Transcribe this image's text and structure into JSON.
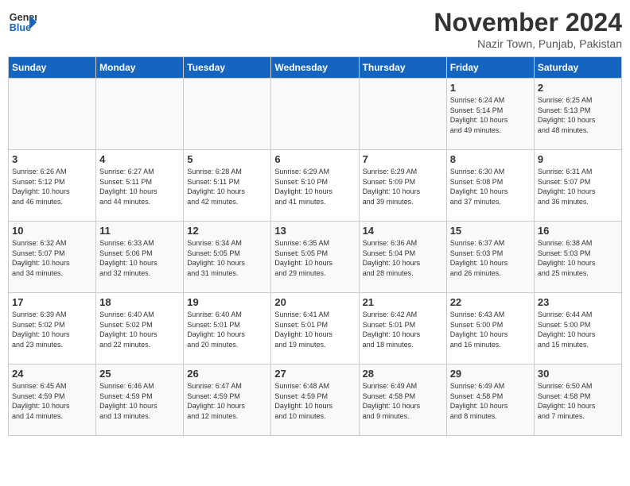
{
  "logo": {
    "line1": "General",
    "line2": "Blue"
  },
  "title": "November 2024",
  "location": "Nazir Town, Punjab, Pakistan",
  "days_header": [
    "Sunday",
    "Monday",
    "Tuesday",
    "Wednesday",
    "Thursday",
    "Friday",
    "Saturday"
  ],
  "weeks": [
    [
      {
        "day": "",
        "info": ""
      },
      {
        "day": "",
        "info": ""
      },
      {
        "day": "",
        "info": ""
      },
      {
        "day": "",
        "info": ""
      },
      {
        "day": "",
        "info": ""
      },
      {
        "day": "1",
        "info": "Sunrise: 6:24 AM\nSunset: 5:14 PM\nDaylight: 10 hours\nand 49 minutes."
      },
      {
        "day": "2",
        "info": "Sunrise: 6:25 AM\nSunset: 5:13 PM\nDaylight: 10 hours\nand 48 minutes."
      }
    ],
    [
      {
        "day": "3",
        "info": "Sunrise: 6:26 AM\nSunset: 5:12 PM\nDaylight: 10 hours\nand 46 minutes."
      },
      {
        "day": "4",
        "info": "Sunrise: 6:27 AM\nSunset: 5:11 PM\nDaylight: 10 hours\nand 44 minutes."
      },
      {
        "day": "5",
        "info": "Sunrise: 6:28 AM\nSunset: 5:11 PM\nDaylight: 10 hours\nand 42 minutes."
      },
      {
        "day": "6",
        "info": "Sunrise: 6:29 AM\nSunset: 5:10 PM\nDaylight: 10 hours\nand 41 minutes."
      },
      {
        "day": "7",
        "info": "Sunrise: 6:29 AM\nSunset: 5:09 PM\nDaylight: 10 hours\nand 39 minutes."
      },
      {
        "day": "8",
        "info": "Sunrise: 6:30 AM\nSunset: 5:08 PM\nDaylight: 10 hours\nand 37 minutes."
      },
      {
        "day": "9",
        "info": "Sunrise: 6:31 AM\nSunset: 5:07 PM\nDaylight: 10 hours\nand 36 minutes."
      }
    ],
    [
      {
        "day": "10",
        "info": "Sunrise: 6:32 AM\nSunset: 5:07 PM\nDaylight: 10 hours\nand 34 minutes."
      },
      {
        "day": "11",
        "info": "Sunrise: 6:33 AM\nSunset: 5:06 PM\nDaylight: 10 hours\nand 32 minutes."
      },
      {
        "day": "12",
        "info": "Sunrise: 6:34 AM\nSunset: 5:05 PM\nDaylight: 10 hours\nand 31 minutes."
      },
      {
        "day": "13",
        "info": "Sunrise: 6:35 AM\nSunset: 5:05 PM\nDaylight: 10 hours\nand 29 minutes."
      },
      {
        "day": "14",
        "info": "Sunrise: 6:36 AM\nSunset: 5:04 PM\nDaylight: 10 hours\nand 28 minutes."
      },
      {
        "day": "15",
        "info": "Sunrise: 6:37 AM\nSunset: 5:03 PM\nDaylight: 10 hours\nand 26 minutes."
      },
      {
        "day": "16",
        "info": "Sunrise: 6:38 AM\nSunset: 5:03 PM\nDaylight: 10 hours\nand 25 minutes."
      }
    ],
    [
      {
        "day": "17",
        "info": "Sunrise: 6:39 AM\nSunset: 5:02 PM\nDaylight: 10 hours\nand 23 minutes."
      },
      {
        "day": "18",
        "info": "Sunrise: 6:40 AM\nSunset: 5:02 PM\nDaylight: 10 hours\nand 22 minutes."
      },
      {
        "day": "19",
        "info": "Sunrise: 6:40 AM\nSunset: 5:01 PM\nDaylight: 10 hours\nand 20 minutes."
      },
      {
        "day": "20",
        "info": "Sunrise: 6:41 AM\nSunset: 5:01 PM\nDaylight: 10 hours\nand 19 minutes."
      },
      {
        "day": "21",
        "info": "Sunrise: 6:42 AM\nSunset: 5:01 PM\nDaylight: 10 hours\nand 18 minutes."
      },
      {
        "day": "22",
        "info": "Sunrise: 6:43 AM\nSunset: 5:00 PM\nDaylight: 10 hours\nand 16 minutes."
      },
      {
        "day": "23",
        "info": "Sunrise: 6:44 AM\nSunset: 5:00 PM\nDaylight: 10 hours\nand 15 minutes."
      }
    ],
    [
      {
        "day": "24",
        "info": "Sunrise: 6:45 AM\nSunset: 4:59 PM\nDaylight: 10 hours\nand 14 minutes."
      },
      {
        "day": "25",
        "info": "Sunrise: 6:46 AM\nSunset: 4:59 PM\nDaylight: 10 hours\nand 13 minutes."
      },
      {
        "day": "26",
        "info": "Sunrise: 6:47 AM\nSunset: 4:59 PM\nDaylight: 10 hours\nand 12 minutes."
      },
      {
        "day": "27",
        "info": "Sunrise: 6:48 AM\nSunset: 4:59 PM\nDaylight: 10 hours\nand 10 minutes."
      },
      {
        "day": "28",
        "info": "Sunrise: 6:49 AM\nSunset: 4:58 PM\nDaylight: 10 hours\nand 9 minutes."
      },
      {
        "day": "29",
        "info": "Sunrise: 6:49 AM\nSunset: 4:58 PM\nDaylight: 10 hours\nand 8 minutes."
      },
      {
        "day": "30",
        "info": "Sunrise: 6:50 AM\nSunset: 4:58 PM\nDaylight: 10 hours\nand 7 minutes."
      }
    ]
  ]
}
